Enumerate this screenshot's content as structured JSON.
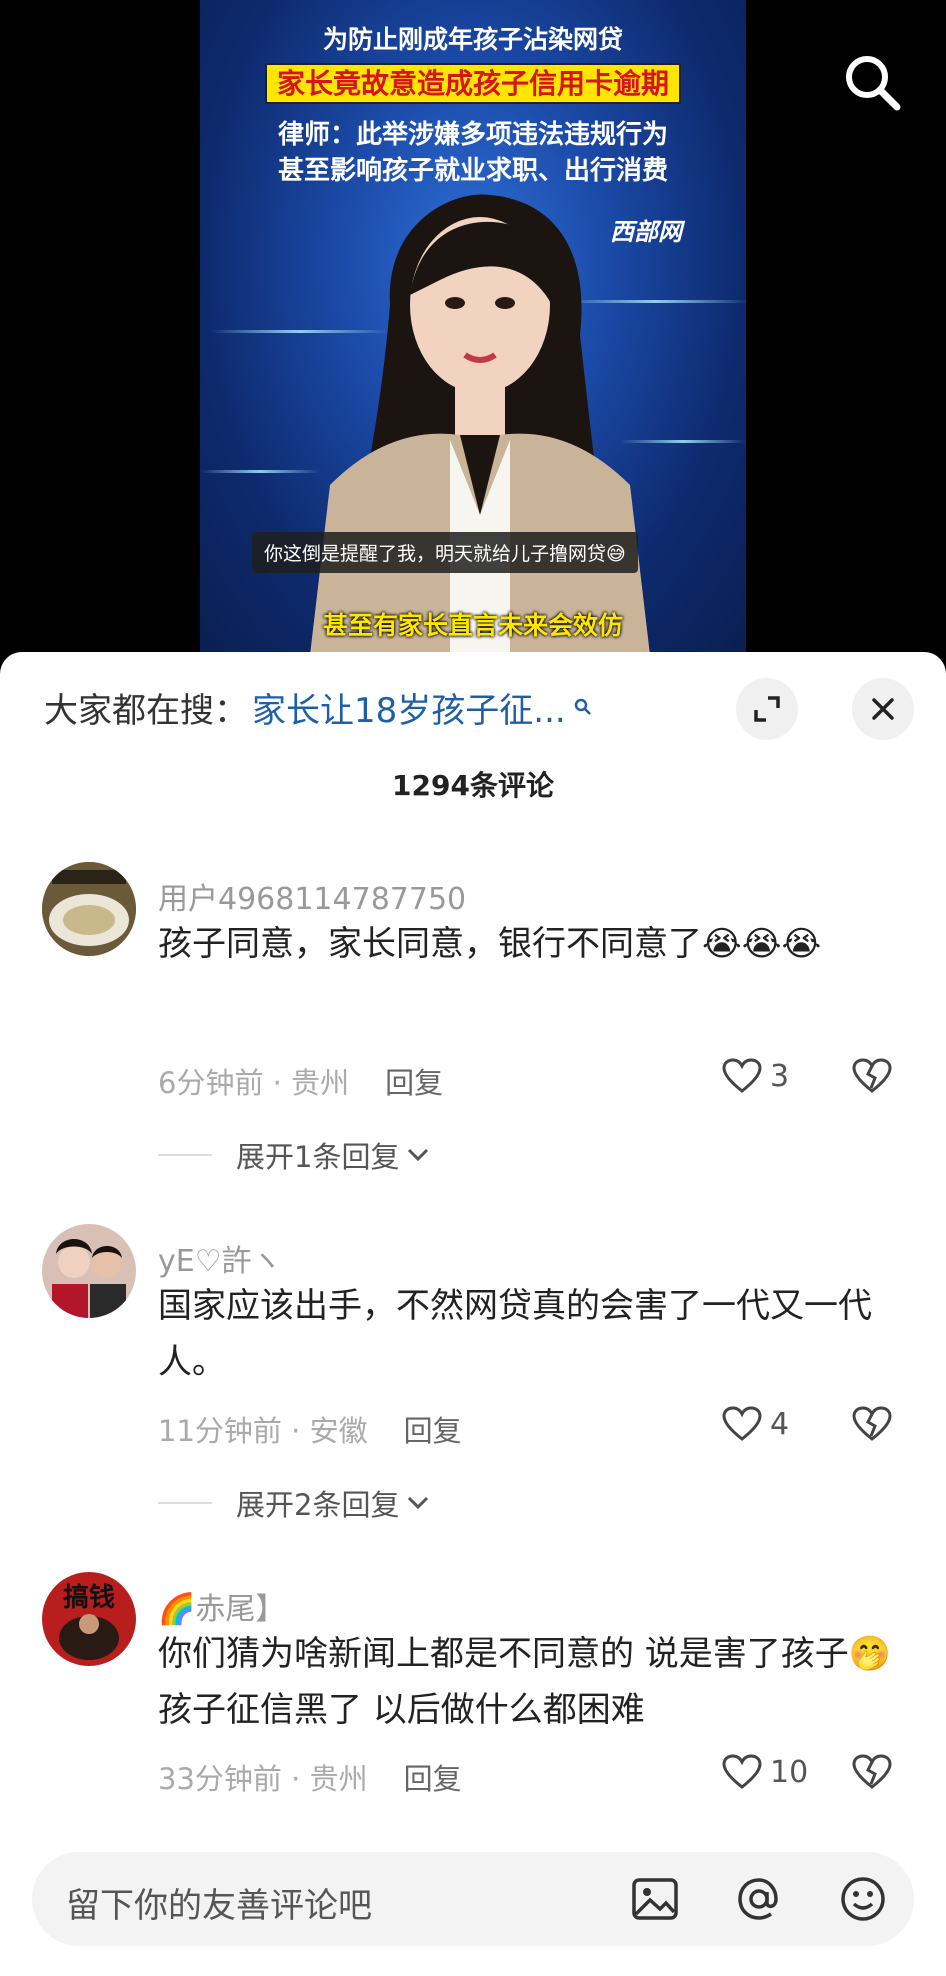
{
  "video": {
    "headline_1": "为防止刚成年孩子沾染网贷",
    "headline_2": "家长竟故意造成孩子信用卡逾期",
    "headline_3": "律师：此举涉嫌多项违法违规行为",
    "headline_4": "甚至影响孩子就业求职、出行消费",
    "source": "西部网",
    "bullet_comment": "你这倒是提醒了我，明天就给儿子撸网贷😅",
    "subtitle": "甚至有家长直言未来会效仿"
  },
  "search": {
    "label": "大家都在搜：",
    "term": "家长让18岁孩子征..."
  },
  "comment_count": "1294条评论",
  "comments": [
    {
      "user": "用户4968114787750",
      "text": "孩子同意，家长同意，银行不同意了😭😭😭",
      "time": "6分钟前",
      "location": "贵州",
      "reply": "回复",
      "likes": "3",
      "expand": "展开1条回复"
    },
    {
      "user": "yE♡許ヽ",
      "text": "国家应该出手，不然网贷真的会害了一代又一代人。",
      "time": "11分钟前",
      "location": "安徽",
      "reply": "回复",
      "likes": "4",
      "expand": "展开2条回复"
    },
    {
      "user": "🌈赤尾】",
      "text": "你们猜为啥新闻上都是不同意的 说是害了孩子🤭 孩子征信黑了 以后做什么都困难",
      "time": "33分钟前",
      "location": "贵州",
      "reply": "回复",
      "likes": "10"
    }
  ],
  "composer": {
    "placeholder": "留下你的友善评论吧"
  },
  "colors": {
    "search_term": "#1f5fa8",
    "headline_highlight": "#ffe600",
    "headline_red": "#d6141c"
  }
}
